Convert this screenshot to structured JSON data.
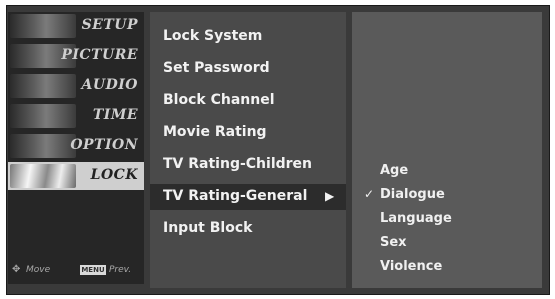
{
  "sidebar": {
    "items": [
      {
        "label": "SETUP"
      },
      {
        "label": "PICTURE"
      },
      {
        "label": "AUDIO"
      },
      {
        "label": "TIME"
      },
      {
        "label": "OPTION"
      },
      {
        "label": "LOCK",
        "selected": true
      }
    ],
    "footer": {
      "move_icon": "move-arrows-icon",
      "move_label": "Move",
      "menu_key": "MENU",
      "prev_label": "Prev."
    }
  },
  "options": {
    "items": [
      {
        "label": "Lock System"
      },
      {
        "label": "Set Password"
      },
      {
        "label": "Block Channel"
      },
      {
        "label": "Movie Rating"
      },
      {
        "label": "TV Rating-Children"
      },
      {
        "label": "TV Rating-General",
        "highlighted": true,
        "has_submenu": true
      },
      {
        "label": "Input Block"
      }
    ],
    "arrow_glyph": "▶"
  },
  "submenu": {
    "items": [
      {
        "label": "Age",
        "checked": false
      },
      {
        "label": "Dialogue",
        "checked": true
      },
      {
        "label": "Language",
        "checked": false
      },
      {
        "label": "Sex",
        "checked": false
      },
      {
        "label": "Violence",
        "checked": false
      }
    ],
    "check_glyph": "✓"
  },
  "colors": {
    "frame": "#3a3a3a",
    "sidebar": "#262626",
    "options_panel": "#4a4a4a",
    "submenu_panel": "#5a5a5a",
    "selected_tab": "#cfcfcf",
    "highlight_row": "#2c2c2c",
    "text": "#f2f2f2"
  }
}
